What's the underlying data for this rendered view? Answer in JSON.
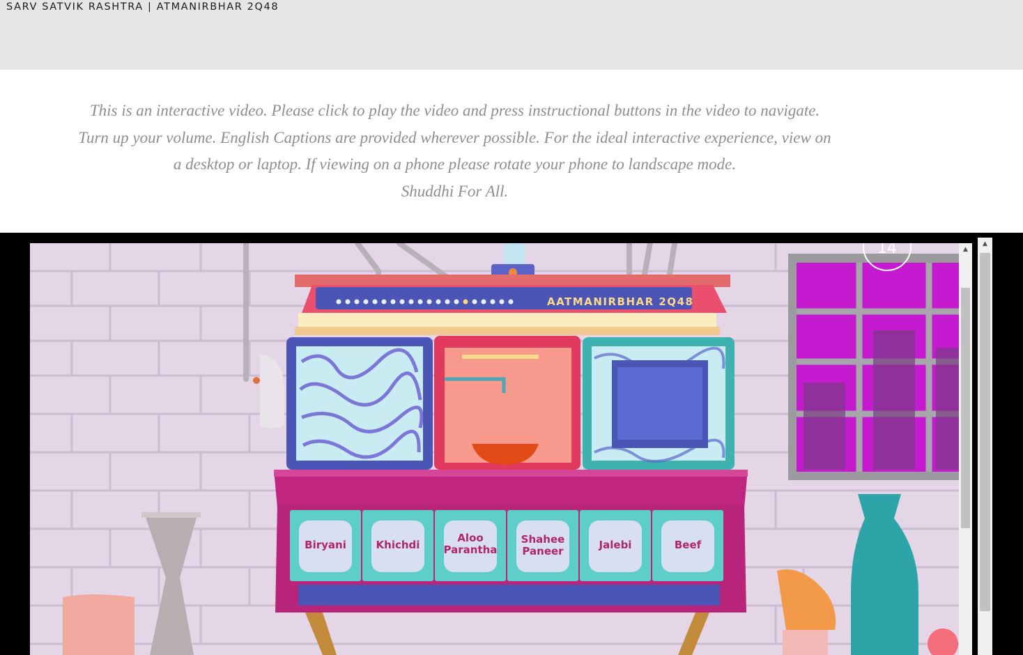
{
  "header": {
    "site_title": "SARV SATVIK RASHTRA | ATMANIRBHAR 2Q48"
  },
  "intro": {
    "lines": [
      "This is an interactive video. Please click to play the video and press instructional buttons in the video to navigate.",
      "Turn up your volume. English Captions are provided wherever possible. For the ideal interactive experience, view on",
      "a desktop or laptop. If viewing on a phone please rotate your phone to landscape mode.",
      "Shuddhi For All."
    ]
  },
  "video": {
    "machine_label": "AATMANIRBHAR 2Q48",
    "counter": "14",
    "drawers": [
      {
        "line1": "Biryani",
        "line2": ""
      },
      {
        "line1": "Khichdi",
        "line2": ""
      },
      {
        "line1": "Aloo",
        "line2": "Parantha"
      },
      {
        "line1": "Shahee",
        "line2": "Paneer"
      },
      {
        "line1": "Jalebi",
        "line2": ""
      },
      {
        "line1": "Beef",
        "line2": ""
      }
    ],
    "colors": {
      "wall": "#e4d6e6",
      "cabinet_magenta": "#c0267f",
      "teal": "#5ecfc8",
      "blue": "#4a55b5",
      "drawer_text": "#b0266e",
      "window_magenta": "#c51ad0"
    }
  },
  "scrollbars": {
    "up_arrow_icon": "▲"
  }
}
